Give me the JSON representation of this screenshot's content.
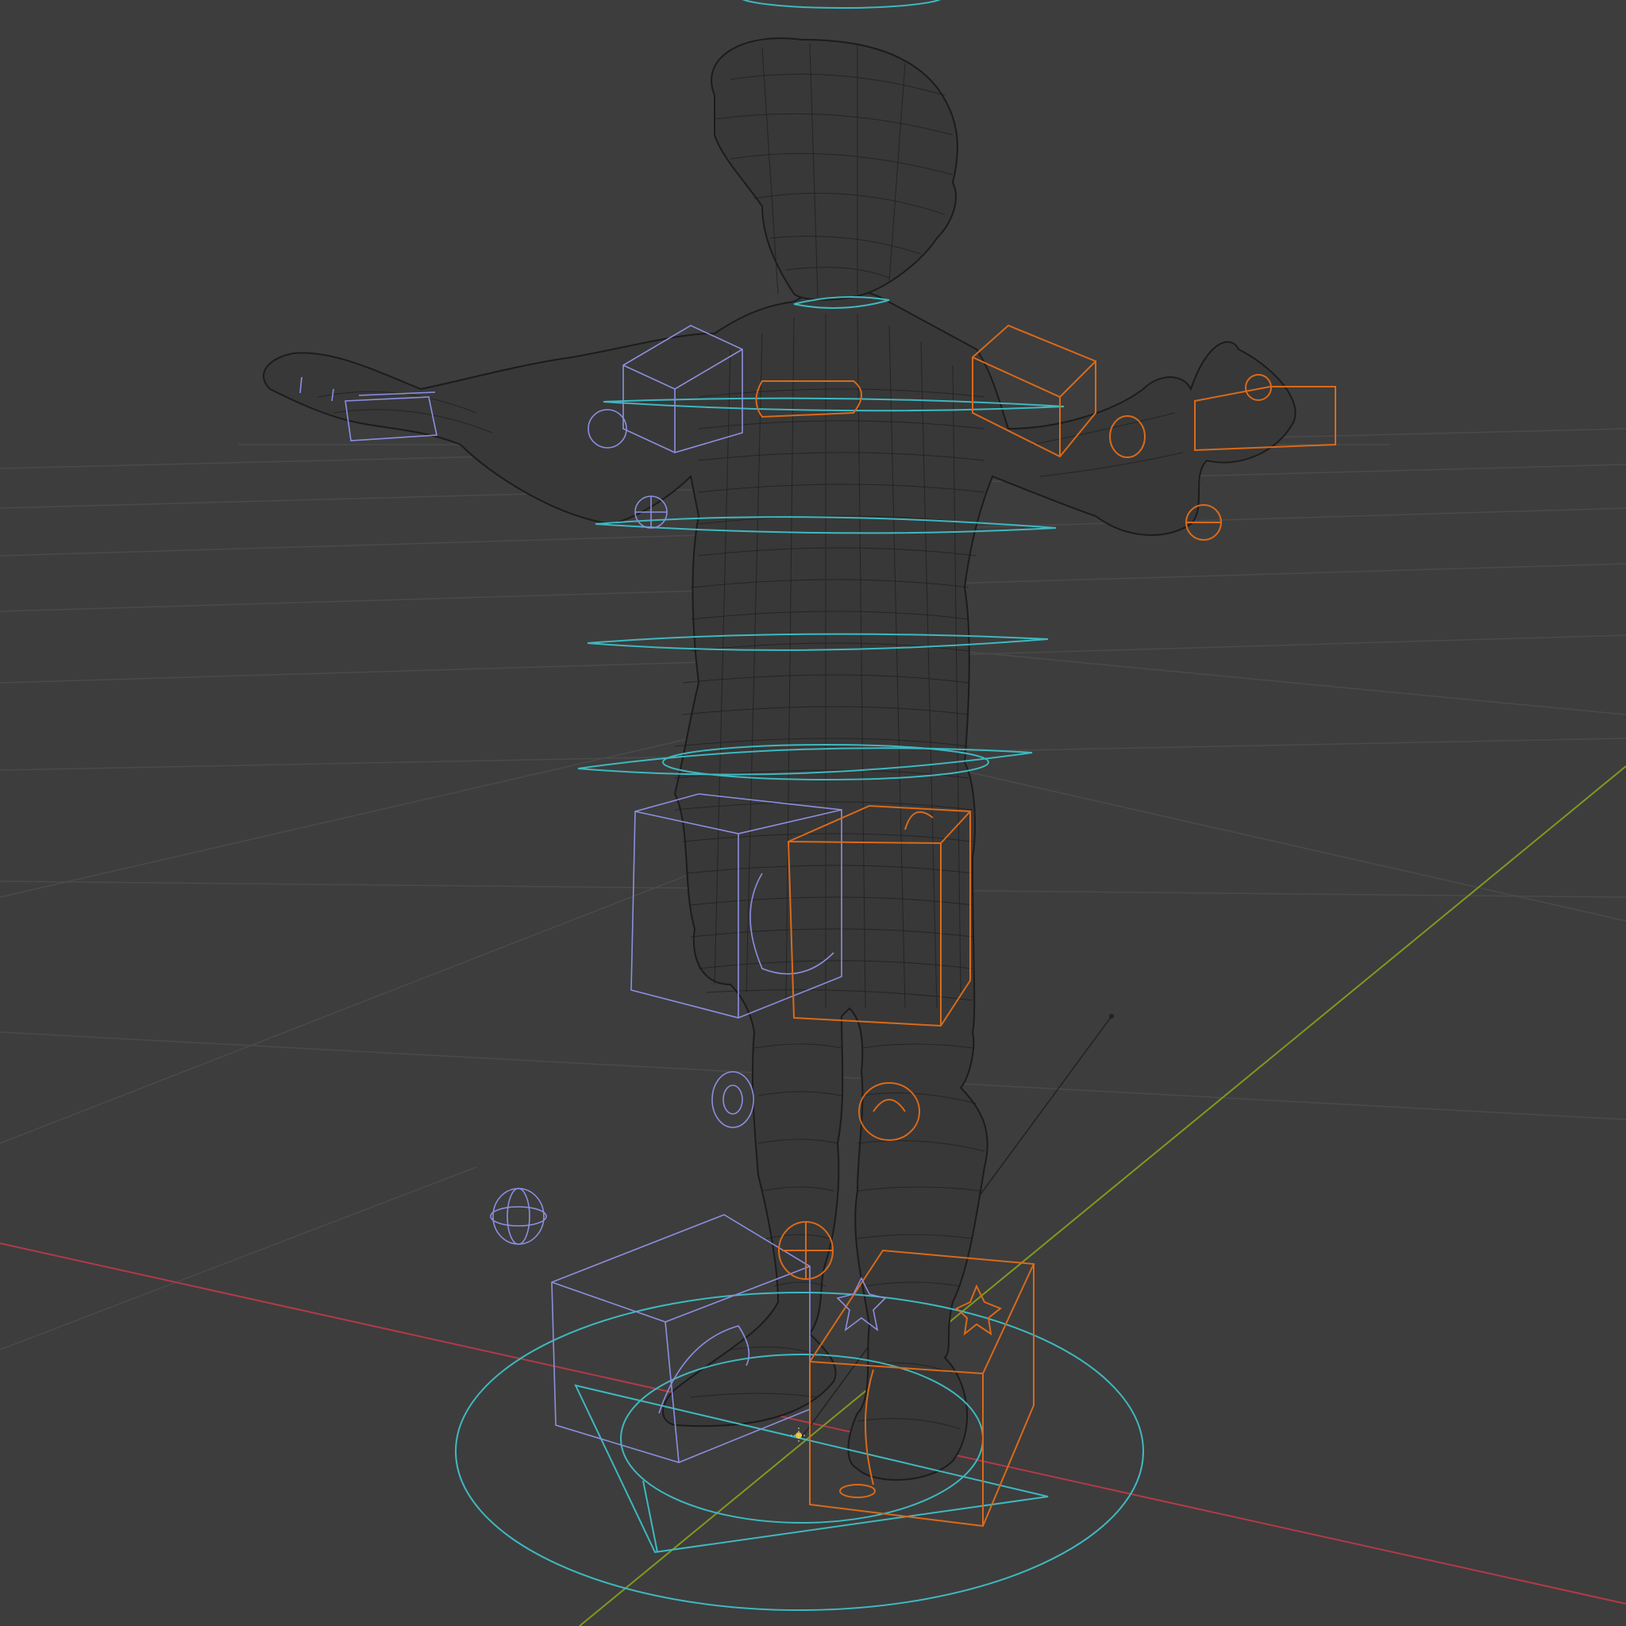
{
  "viewport": {
    "view_mode": "wireframe",
    "object": "rigged-character",
    "colors": {
      "background": "#3d3d3d",
      "grid": "#4a4a4a",
      "x_axis": "#b23a48",
      "y_axis": "#7f9a1f",
      "mesh_wire": "#1c1c1c",
      "control_center": "#3fb8c0",
      "control_left": "#8c8fe0",
      "control_right": "#d96a1a",
      "origin_marker": "#e8c020"
    },
    "icons": [
      "origin-marker-icon",
      "light-icon"
    ]
  }
}
